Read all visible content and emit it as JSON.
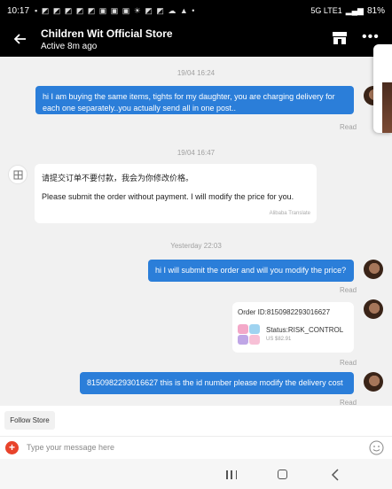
{
  "status_bar": {
    "time": "10:17",
    "notification_icons": "▪ ◩ ◩ ◩ ◩ ◩ ▣ ▣ ▣ ☀ ◩ ◩ ☁ ▲ •",
    "network": "5G LTE1",
    "battery": "81%"
  },
  "header": {
    "store_name": "Children Wit Official Store",
    "active_status": "Active 8m ago"
  },
  "messages": [
    {
      "timestamp": "19/04 16:24",
      "text": "hi I am buying the same items, tights for my daughter, you are charging delivery for each one separately..you actually send all in one post..",
      "read": "Read"
    },
    {
      "timestamp": "19/04 16:47",
      "original": "请提交订单不要付款，我会为你修改价格。",
      "translation": "Please submit the order without payment. I will modify the price for you.",
      "translator": "Alibaba Translate"
    },
    {
      "timestamp": "Yesterday 22:03",
      "text": "hi I will submit the order and will you modify the price?",
      "read": "Read"
    },
    {
      "order_id": "Order ID:8150982293016627",
      "status": "Status:RISK_CONTROL",
      "price": "US $82.91",
      "read": "Read"
    },
    {
      "text": "8150982293016627 this is the id number please modify the delivery cost",
      "read": "Read"
    }
  ],
  "follow_bar": {
    "button_label": "Follow Store"
  },
  "composer": {
    "placeholder": "Type your message here"
  },
  "colors": {
    "accent": "#2b7ed9",
    "header": "#000000",
    "plus": "#e8432b",
    "background": "#f1f1f1"
  }
}
